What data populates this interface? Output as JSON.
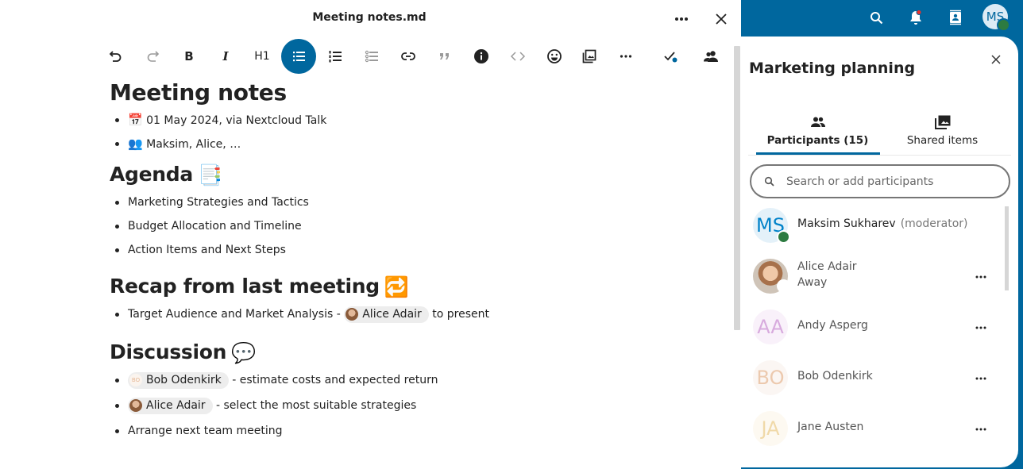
{
  "editor": {
    "file_title": "Meeting notes.md",
    "more_label": "More actions",
    "close_label": "Close",
    "toolbar": {
      "h1_label": "H1",
      "buttons": [
        "undo",
        "redo",
        "bold",
        "italic",
        "heading",
        "bullet-list",
        "numbered-list",
        "task-list",
        "link",
        "blockquote",
        "callout-info",
        "code",
        "emoji",
        "insert-image",
        "more",
        "save-status",
        "sessions"
      ]
    },
    "document": {
      "title": "Meeting notes",
      "meta": [
        {
          "emoji": "📅",
          "text": "01 May 2024, via Nextcloud Talk"
        },
        {
          "emoji": "👥",
          "text": "Maksim, Alice, …"
        }
      ],
      "agenda": {
        "heading": "Agenda",
        "emoji": "📑",
        "items": [
          "Marketing Strategies and Tactics",
          "Budget Allocation and Timeline",
          "Action Items and Next Steps"
        ]
      },
      "recap": {
        "heading": "Recap from last meeting",
        "emoji": "🔁",
        "items": [
          {
            "before": "Target Audience and Market Analysis - ",
            "mention": "Alice Adair",
            "after": "to present"
          }
        ]
      },
      "discussion": {
        "heading": "Discussion",
        "emoji": "💬",
        "items": [
          {
            "mention": "Bob Odenkirk",
            "mention_initials": "BO",
            "after": "- estimate costs and expected return"
          },
          {
            "mention": "Alice Adair",
            "after": "- select the most suitable strategies"
          },
          {
            "text": "Arrange next team meeting"
          }
        ]
      }
    }
  },
  "header": {
    "icons": [
      "search-icon",
      "notifications-icon",
      "contacts-icon"
    ],
    "user_initials": "MS",
    "colors": {
      "brand": "#00679e",
      "online": "#2d7b41",
      "notification_dot": "#e9322d"
    }
  },
  "sidebar": {
    "title": "Marketing planning",
    "tabs": [
      {
        "label": "Participants (15)",
        "active": true
      },
      {
        "label": "Shared items",
        "active": false
      }
    ],
    "search_placeholder": "Search or add participants",
    "participants": [
      {
        "initials": "MS",
        "name": "Maksim Sukharev",
        "role": "(moderator)",
        "status": "online",
        "color": "#0082c9",
        "bg": "#e4f1f9"
      },
      {
        "initials": "",
        "name": "Alice Adair",
        "status_text": "Away",
        "status": "away"
      },
      {
        "initials": "AA",
        "name": "Andy Asperg",
        "color": "#d8abde",
        "bg": "#f9f1fa"
      },
      {
        "initials": "BO",
        "name": "Bob Odenkirk",
        "color": "#ecc9ae",
        "bg": "#fbf6f3"
      },
      {
        "initials": "JA",
        "name": "Jane Austen",
        "color": "#f0d9a8",
        "bg": "#fdf9f1"
      }
    ]
  }
}
